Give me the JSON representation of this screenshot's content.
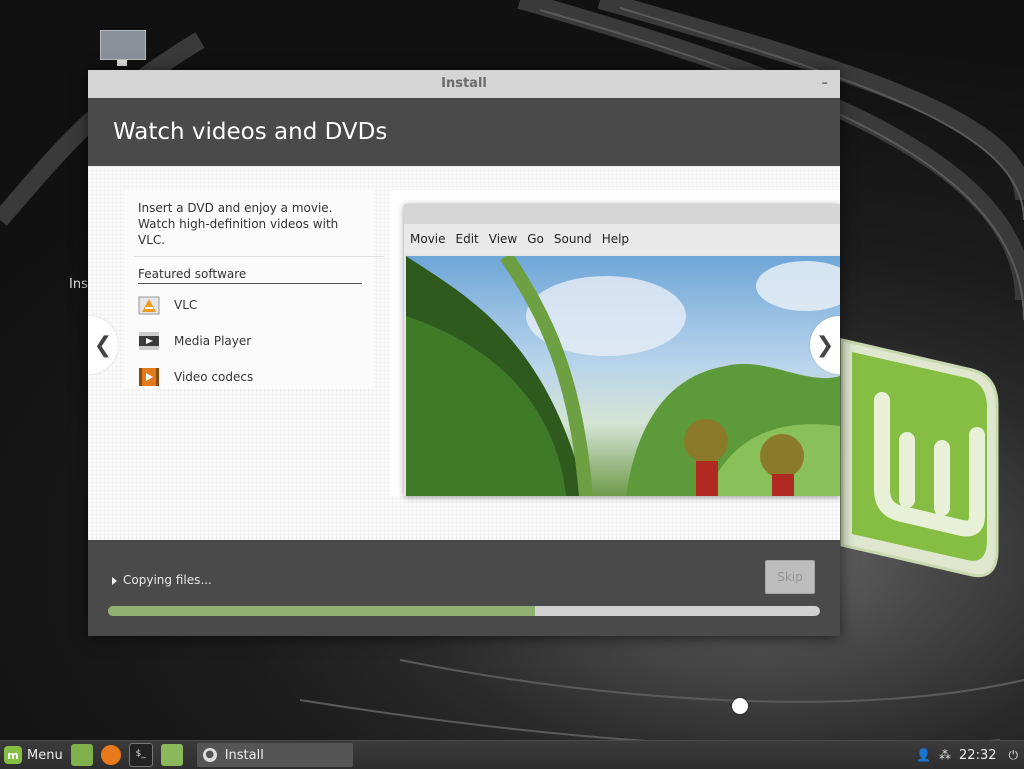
{
  "desktop": {
    "icon_label": "Ins"
  },
  "window": {
    "title": "Install",
    "minimize_symbol": "–"
  },
  "slide": {
    "title": "Watch videos and DVDs",
    "description": "Insert a DVD and enjoy a movie. Watch high-definition videos with VLC.",
    "featured_heading": "Featured software",
    "software": [
      {
        "name": "VLC",
        "icon": "vlc-icon"
      },
      {
        "name": "Media Player",
        "icon": "media-player-icon"
      },
      {
        "name": "Video codecs",
        "icon": "video-codecs-icon"
      }
    ],
    "prev_symbol": "❮",
    "next_symbol": "❯",
    "vlc_menu": [
      "Movie",
      "Edit",
      "View",
      "Go",
      "Sound",
      "Help"
    ]
  },
  "footer": {
    "status": "Copying files...",
    "skip_label": "Skip",
    "progress_percent": 60
  },
  "taskbar": {
    "menu_label": "Menu",
    "task_label": "Install",
    "clock": "22:32"
  },
  "colors": {
    "accent": "#8fb06e",
    "header_bg": "#4a4a4a",
    "mint_green": "#86be43"
  }
}
